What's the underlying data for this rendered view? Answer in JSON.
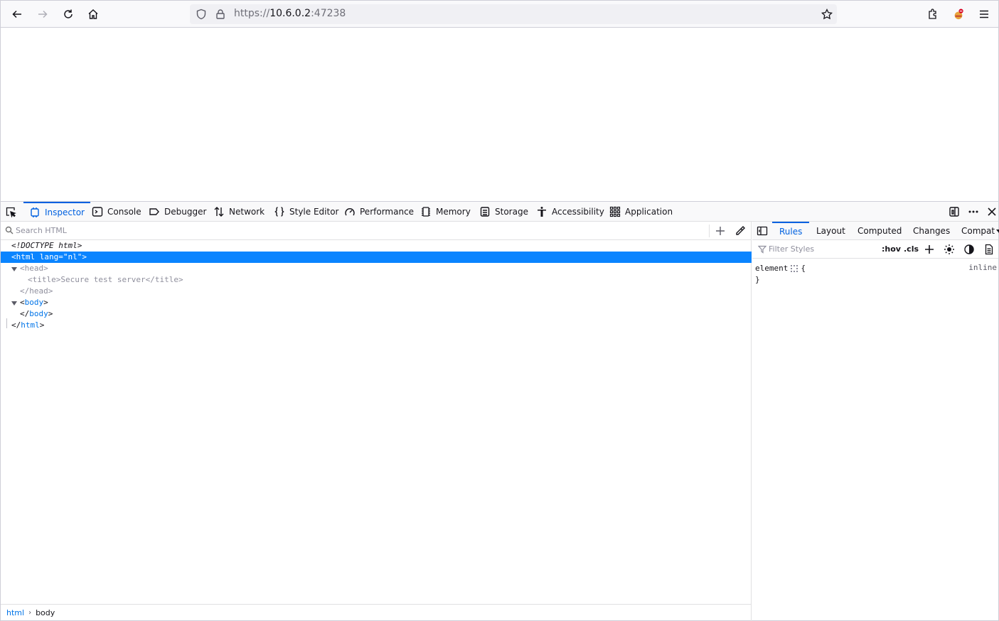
{
  "browser": {
    "url_scheme": "https://",
    "url_host": "10.6.0.2",
    "url_port": ":47238",
    "icons": [
      "back-icon",
      "forward-icon",
      "reload-icon",
      "home-icon",
      "shield-icon",
      "lock-icon",
      "star-icon",
      "extensions-icon",
      "profile-icon",
      "menu-icon"
    ]
  },
  "devtools": {
    "tabs": [
      {
        "label": "Inspector",
        "icon": "inspector-icon"
      },
      {
        "label": "Console",
        "icon": "console-icon"
      },
      {
        "label": "Debugger",
        "icon": "debugger-icon"
      },
      {
        "label": "Network",
        "icon": "network-icon"
      },
      {
        "label": "Style Editor",
        "icon": "style-editor-icon"
      },
      {
        "label": "Performance",
        "icon": "performance-icon"
      },
      {
        "label": "Memory",
        "icon": "memory-icon"
      },
      {
        "label": "Storage",
        "icon": "storage-icon"
      },
      {
        "label": "Accessibility",
        "icon": "accessibility-icon"
      },
      {
        "label": "Application",
        "icon": "application-icon"
      }
    ],
    "active_tab": "Inspector",
    "markup": {
      "search_placeholder": "Search HTML",
      "doctype": "<!DOCTYPE html>",
      "html_open_tag": "html",
      "html_attr_name": "lang",
      "html_attr_value": "\"nl\"",
      "head_tag": "head",
      "title_tag": "title",
      "title_text": "Secure test server",
      "body_tag": "body",
      "breadcrumbs": [
        "html",
        "body"
      ]
    },
    "sidebar": {
      "tabs": [
        "Rules",
        "Layout",
        "Computed",
        "Changes",
        "Compat"
      ],
      "active_tab": "Rules",
      "filter_placeholder": "Filter Styles",
      "hov_label": ":hov",
      "cls_label": ".cls",
      "rule_selector": "element",
      "rule_open": "{",
      "rule_close": "}",
      "rule_source": "inline"
    }
  },
  "colors": {
    "accent": "#0061e0",
    "selection": "#0a84ff",
    "tag": "#0074e8",
    "attr": "#dd00a9"
  }
}
